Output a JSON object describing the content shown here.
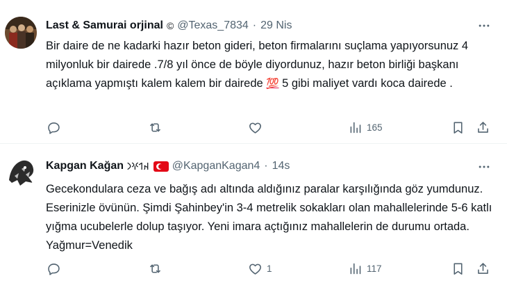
{
  "tweets": [
    {
      "display_name": "Last & Samurai orjinal",
      "name_extra": "©",
      "handle": "@Texas_7834",
      "separator": "·",
      "time": "29 Nis",
      "text_before_emoji": "Bir daire de ne kadarki hazır beton gideri, beton firmalarını suçlama yapıyorsunuz 4 milyonluk bir dairede .7/8 yıl önce de böyle diyordunuz, hazır beton birliği başkanı açıklama yapmıştı kalem kalem bir dairede ",
      "emoji": "💯",
      "text_after_emoji": " 5 gibi maliyet vardı koca dairede .",
      "actions": {
        "replies": "",
        "retweets": "",
        "likes": "",
        "views": "165"
      }
    },
    {
      "display_name": "Kapgan Kağan",
      "name_extra": "𐰴𐰯𐰍𐰣",
      "handle": "@KapganKagan4",
      "separator": "·",
      "time": "14s",
      "text": "Gecekondulara ceza ve bağış adı altında aldığınız paralar karşılığında göz yumdunuz.  Eserinizle övünün. Şimdi Şahinbey'in 3-4 metrelik sokakları olan mahallelerinde 5-6 katlı yığma ucubelerle dolup taşıyor. Yeni imara açtığınız mahallelerin de durumu ortada. Yağmur=Venedik",
      "actions": {
        "replies": "",
        "retweets": "",
        "likes": "1",
        "views": "117"
      }
    }
  ],
  "icons": {
    "reply": "reply-icon",
    "retweet": "retweet-icon",
    "like": "heart-icon",
    "views": "views-icon",
    "bookmark": "bookmark-icon",
    "share": "share-icon",
    "more": "more-icon"
  },
  "colors": {
    "text": "#0f1419",
    "secondary": "#536471",
    "divider": "#eff3f4",
    "flag": "#e30a17"
  }
}
